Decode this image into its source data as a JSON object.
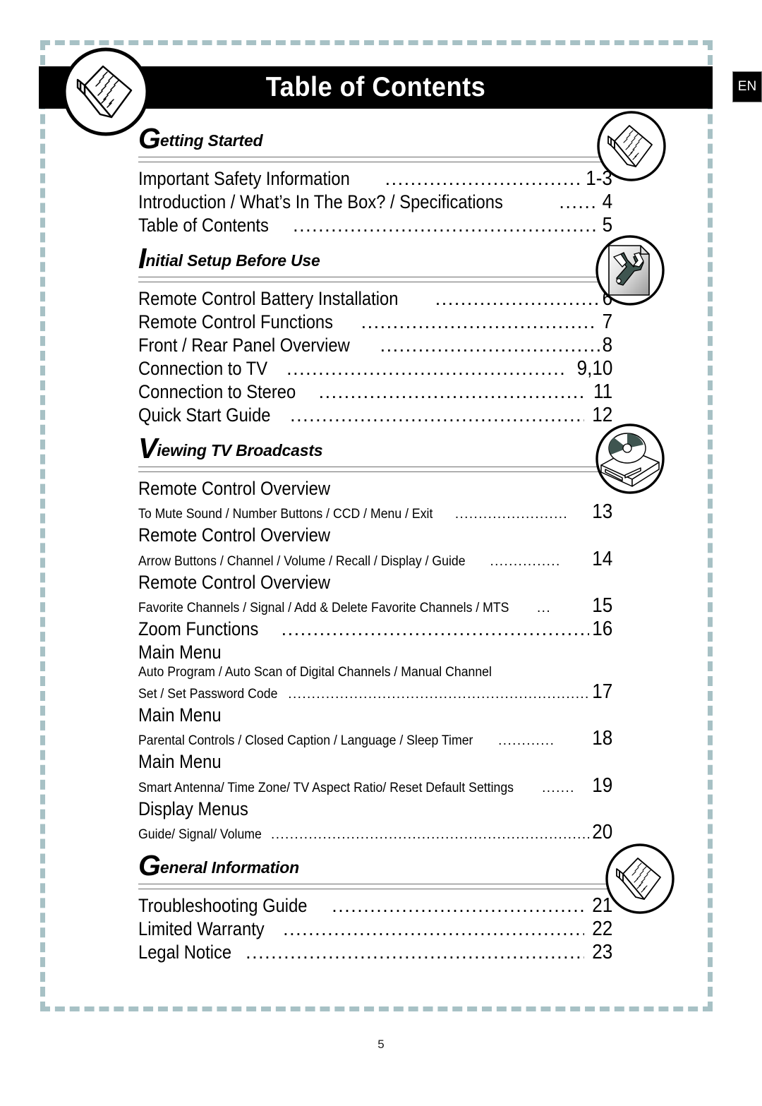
{
  "document": {
    "title": "Table of Contents",
    "language_badge": "EN",
    "footer_page_number": "5"
  },
  "icons": {
    "header_emblem": "open-book-icon",
    "getting_started": "open-book-icon",
    "initial_setup": "wrench-tools-icon",
    "viewing_tv": "disc-player-icon",
    "general_information": "open-book-icon"
  },
  "colors": {
    "frame_dash": "#a7c1c5",
    "title_bar_bg": "#000000",
    "title_bar_text": "#ffffff",
    "rule": "#6d6d6d",
    "body_text": "#000000"
  },
  "sections": [
    {
      "cap": "G",
      "rest": "etting Started",
      "entries": [
        {
          "kind": "entry",
          "title": "Important Safety Information",
          "leader": "...............................................",
          "page": "1-3",
          "lead_gap": true
        },
        {
          "kind": "entry",
          "title": "Introduction / What’s In The Box? / Specifications",
          "leader": "............",
          "page": "4",
          "lead_gap": true,
          "num_gap": true
        },
        {
          "kind": "entry",
          "title": "Table of Contents",
          "leader": ".................................................................",
          "page": "5",
          "lead_gap": true,
          "num_gap": true
        }
      ]
    },
    {
      "cap": "I",
      "rest": "nitial Setup Before Use",
      "entries": [
        {
          "kind": "entry",
          "title": "Remote Control Battery Installation",
          "leader": "...................................",
          "page": "6"
        },
        {
          "kind": "entry",
          "title": "Remote Control Functions",
          "leader": "................................................",
          "page": "7",
          "num_gap": true
        },
        {
          "kind": "entry",
          "title": "Front / Rear Panel Overview",
          "leader": ".............................................",
          "page": "8"
        },
        {
          "kind": "entry",
          "title": "Connection to TV",
          "leader": "..............................................................",
          "page": "9,10",
          "num_gap": true
        },
        {
          "kind": "entry",
          "title": "Connection to Stereo",
          "leader": ".........................................................",
          "page": "11",
          "num_gap": true
        },
        {
          "kind": "entry",
          "title": "Quick Start Guide",
          "leader": "................................................................",
          "page": "12",
          "num_gap": true
        }
      ]
    },
    {
      "cap": "V",
      "rest": "iewing TV Broadcasts",
      "entries": [
        {
          "kind": "big",
          "title": "Remote Control Overview"
        },
        {
          "kind": "sub",
          "title": "To Mute Sound / Number Buttons / CCD / Menu / Exit",
          "leader": "........................",
          "page": "13"
        },
        {
          "kind": "big",
          "title": "Remote Control Overview"
        },
        {
          "kind": "sub",
          "title": "Arrow Buttons / Channel / Volume / Recall / Display / Guide",
          "leader": "...............",
          "page": "14"
        },
        {
          "kind": "big",
          "title": "Remote Control Overview"
        },
        {
          "kind": "sub",
          "title": "Favorite Channels / Signal / Add & Delete Favorite Channels / MTS",
          "leader": "...",
          "page": "15"
        },
        {
          "kind": "entry",
          "title": "Zoom Functions",
          "leader": ".................................................................",
          "page": "16",
          "lead_gap": true
        },
        {
          "kind": "big",
          "title": "Main Menu"
        },
        {
          "kind": "plain",
          "title": "Auto Program / Auto Scan of Digital Channels / Manual Channel"
        },
        {
          "kind": "sub",
          "title": "Set / Set Password Code",
          "leader": "......................................................................",
          "page": "17"
        },
        {
          "kind": "big",
          "title": "Main Menu"
        },
        {
          "kind": "sub",
          "title": "Parental Controls / Closed Caption / Language / Sleep Timer",
          "leader": "............",
          "page": "18",
          "num_gap": true
        },
        {
          "kind": "big",
          "title": "Main Menu"
        },
        {
          "kind": "sub",
          "title": "Smart Antenna/ Time Zone/ TV Aspect Ratio/ Reset Default Settings",
          "leader": ".......",
          "page": "19"
        },
        {
          "kind": "big",
          "title": "Display Menus"
        },
        {
          "kind": "sub",
          "title": "Guide/ Signal/ Volume",
          "leader": "........................................................................",
          "page": "20"
        }
      ]
    },
    {
      "cap": "G",
      "rest": "eneral Information",
      "entries": [
        {
          "kind": "entry",
          "title": "Troubleshooting Guide",
          "leader": ".................................................",
          "page": "21",
          "num_gap": true
        },
        {
          "kind": "entry",
          "title": "Limited Warranty",
          "leader": "..............................................................",
          "page": "22",
          "num_gap": true
        },
        {
          "kind": "entry",
          "title": "Legal Notice",
          "leader": "....................................................................",
          "page": "23",
          "num_gap": true
        }
      ]
    }
  ]
}
